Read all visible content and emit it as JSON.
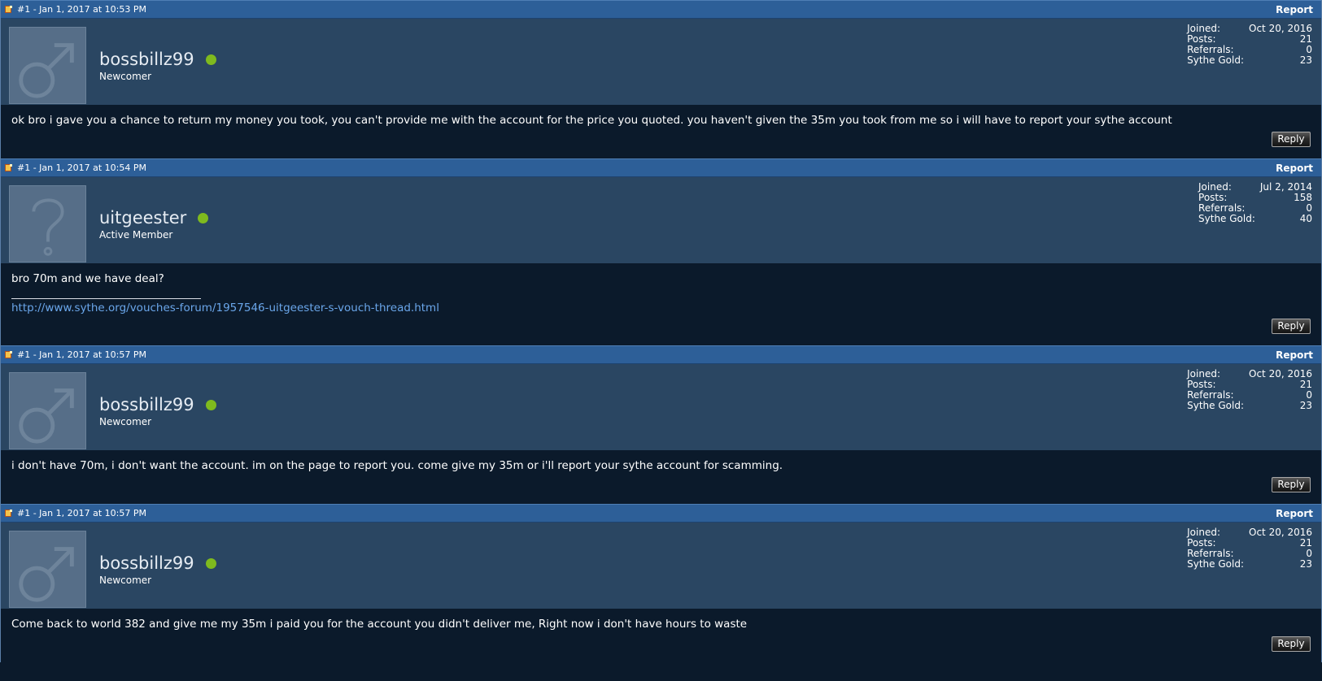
{
  "posts": [
    {
      "number": "#1 - Jan 1, 2017 at 10:53 PM",
      "report_label": "Report",
      "avatar_icon": "male-symbol-icon",
      "username": "bossbillz99",
      "rank": "Newcomer",
      "stats": [
        {
          "label": "Joined:",
          "value": "Oct 20, 2016"
        },
        {
          "label": "Posts:",
          "value": "21"
        },
        {
          "label": "Referrals:",
          "value": "0"
        },
        {
          "label": "Sythe Gold:",
          "value": "23"
        }
      ],
      "message": "ok bro i gave you a chance to return my money you took, you can't provide me with the account for the price you quoted. you haven't given the 35m you took from me so i will have to report your sythe account",
      "reply_label": "Reply"
    },
    {
      "number": "#1 - Jan 1, 2017 at 10:54 PM",
      "report_label": "Report",
      "avatar_icon": "question-mark-icon",
      "username": "uitgeester",
      "rank": "Active Member",
      "stats": [
        {
          "label": "Joined:",
          "value": "Jul 2, 2014"
        },
        {
          "label": "Posts:",
          "value": "158"
        },
        {
          "label": "Referrals:",
          "value": "0"
        },
        {
          "label": "Sythe Gold:",
          "value": "40"
        }
      ],
      "message": "bro 70m and we have deal?",
      "signature_link": "http://www.sythe.org/vouches-forum/1957546-uitgeester-s-vouch-thread.html",
      "reply_label": "Reply"
    },
    {
      "number": "#1 - Jan 1, 2017 at 10:57 PM",
      "report_label": "Report",
      "avatar_icon": "male-symbol-icon",
      "username": "bossbillz99",
      "rank": "Newcomer",
      "stats": [
        {
          "label": "Joined:",
          "value": "Oct 20, 2016"
        },
        {
          "label": "Posts:",
          "value": "21"
        },
        {
          "label": "Referrals:",
          "value": "0"
        },
        {
          "label": "Sythe Gold:",
          "value": "23"
        }
      ],
      "message": "i don't have 70m, i don't want the account. im on the page to report you. come give my 35m or i'll report your sythe account for scamming.",
      "reply_label": "Reply"
    },
    {
      "number": "#1 - Jan 1, 2017 at 10:57 PM",
      "report_label": "Report",
      "avatar_icon": "male-symbol-icon",
      "username": "bossbillz99",
      "rank": "Newcomer",
      "stats": [
        {
          "label": "Joined:",
          "value": "Oct 20, 2016"
        },
        {
          "label": "Posts:",
          "value": "21"
        },
        {
          "label": "Referrals:",
          "value": "0"
        },
        {
          "label": "Sythe Gold:",
          "value": "23"
        }
      ],
      "message": "Come back to world 382 and give me my 35m i paid you for the account you didn't deliver me, Right now i don't have hours to waste",
      "reply_label": "Reply"
    }
  ],
  "colors": {
    "header_bar": "#2d5f98",
    "user_panel": "#2a4662",
    "body_bg": "#0b1a2b",
    "online_dot": "#7fba1e",
    "link": "#6aa6ea"
  }
}
